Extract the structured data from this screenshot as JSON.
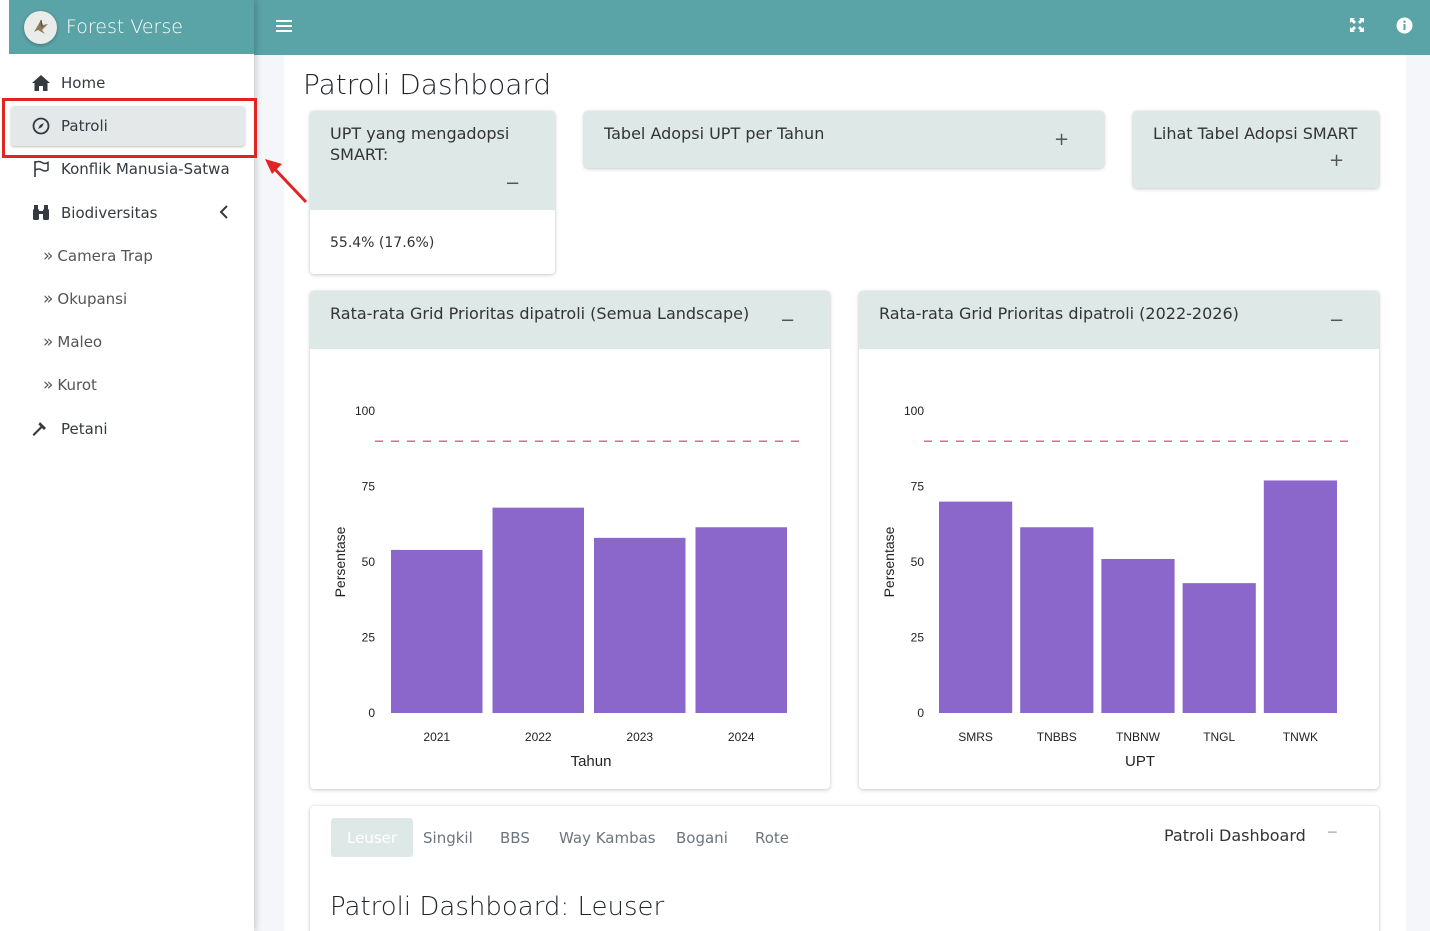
{
  "brand": {
    "name": "Forest Verse"
  },
  "sidebar": {
    "items": [
      {
        "label": "Home",
        "icon": "home-icon"
      },
      {
        "label": "Patroli",
        "icon": "compass-icon",
        "active": true
      },
      {
        "label": "Konflik Manusia-Satwa",
        "icon": "flag-icon"
      },
      {
        "label": "Biodiversitas",
        "icon": "binoculars-icon"
      },
      {
        "label": "Petani",
        "icon": "hammer-icon"
      }
    ],
    "subitems": [
      {
        "label": "Camera Trap"
      },
      {
        "label": "Okupansi"
      },
      {
        "label": "Maleo"
      },
      {
        "label": "Kurot"
      }
    ]
  },
  "page": {
    "title": "Patroli Dashboard"
  },
  "cards": {
    "kpi": {
      "title": "UPT yang mengadopsi SMART:",
      "value": "55.4% (17.6%)",
      "tool": "−"
    },
    "table_adopsi": {
      "title": "Tabel Adopsi UPT per Tahun",
      "tool": "+"
    },
    "smart_table": {
      "title": "Lihat Tabel Adopsi SMART",
      "tool": "+"
    },
    "chart1": {
      "title": "Rata-rata Grid Prioritas dipatroli (Semua Landscape)",
      "tool": "−"
    },
    "chart2": {
      "title": "Rata-rata Grid Prioritas dipatroli (2022-2026)",
      "tool": "−"
    }
  },
  "chart_data": [
    {
      "type": "bar",
      "categories": [
        "2021",
        "2022",
        "2023",
        "2024"
      ],
      "values": [
        54,
        68,
        58,
        61.5
      ],
      "xlabel": "Tahun",
      "ylabel": "Persentase",
      "ylim": [
        0,
        100
      ],
      "yticks": [
        "0",
        "25",
        "50",
        "75",
        "100"
      ],
      "reference_line": 90,
      "bar_color": "#8b67cc",
      "line_color": "#f06292"
    },
    {
      "type": "bar",
      "categories": [
        "SMRS",
        "TNBBS",
        "TNBNW",
        "TNGL",
        "TNWK"
      ],
      "values": [
        70,
        61.5,
        51,
        43,
        77
      ],
      "xlabel": "UPT",
      "ylabel": "Persentase",
      "ylim": [
        0,
        100
      ],
      "yticks": [
        "0",
        "25",
        "50",
        "75",
        "100"
      ],
      "reference_line": 90,
      "bar_color": "#8b67cc",
      "line_color": "#f06292"
    }
  ],
  "tabs": {
    "items": [
      "Leuser",
      "Singkil",
      "BBS",
      "Way Kambas",
      "Bogani",
      "Rote"
    ],
    "right_label": "Patroli Dashboard",
    "tool": "−",
    "content_title": "Patroli Dashboard: Leuser"
  },
  "colors": {
    "accent": "#5aa3a6",
    "card_header": "#dee8e7",
    "highlight": "#e32222"
  }
}
